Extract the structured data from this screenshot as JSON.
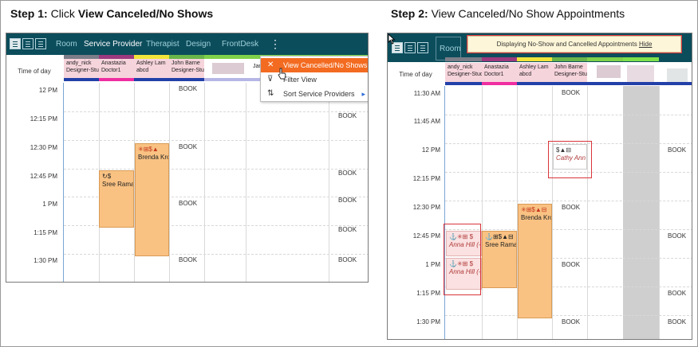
{
  "step1": {
    "label": "Step 1:",
    "text_pre": "Click ",
    "text_bold": "View Canceled/No Shows"
  },
  "step2": {
    "label": "Step 2:",
    "text": "View Canceled/No Show Appointments"
  },
  "tabs": [
    "Room",
    "Service Provider",
    "Therapist",
    "Design",
    "FrontDesk"
  ],
  "tab_room": "Room",
  "time_of_day": "Time of day",
  "left": {
    "providers": [
      {
        "name": "andy_nick",
        "role": "Designer-Stud"
      },
      {
        "name": "Anastazia",
        "role": "Doctor1"
      },
      {
        "name": "Ashley Lam",
        "role": "abcd"
      },
      {
        "name": "John Barne",
        "role": "Designer-Stud"
      },
      {
        "name": "Jan",
        "role": ""
      }
    ],
    "times": [
      "12 PM",
      "12:15 PM",
      "12:30 PM",
      "12:45 PM",
      "1 PM",
      "1:15 PM",
      "1:30 PM"
    ],
    "appts": [
      {
        "icons": "✳⊞$▲",
        "name": "Brenda Kro"
      },
      {
        "icons": "↻$",
        "name": "Sree Rama"
      }
    ],
    "menu": [
      {
        "icon": "✕",
        "label": "View Cancelled/No Shows"
      },
      {
        "icon": "⊽",
        "label": "Filter View"
      },
      {
        "icon": "⇅",
        "label": "Sort Service Providers"
      }
    ],
    "more_icon": "⋮",
    "submenu_arrow": "▸",
    "book": "BOOK"
  },
  "right": {
    "banner_text": "Displaying No-Show and Cancelled Appointments ",
    "banner_link": "Hide",
    "providers": [
      {
        "name": "andy_nick",
        "role": "Designer-Stud"
      },
      {
        "name": "Anastazia",
        "role": "Doctor1"
      },
      {
        "name": "Ashley Lam",
        "role": "abcd"
      },
      {
        "name": "John Barne",
        "role": "Designer-Stud"
      }
    ],
    "times": [
      "11:30 AM",
      "11:45 AM",
      "12 PM",
      "12:15 PM",
      "12:30 PM",
      "12:45 PM",
      "1 PM",
      "1:15 PM",
      "1:30 PM"
    ],
    "cancel_appt": {
      "icons": "$▲⊟",
      "name": "Cathy Ann"
    },
    "anna1": {
      "icons": "⚓✳⊞ $",
      "name": "Anna Hill (-"
    },
    "anna2": {
      "icons": "⚓✳⊞ $",
      "name": "Anna Hill (-"
    },
    "sree": {
      "icons": "⚓⊞$▲⊟",
      "name": "Sree Rama"
    },
    "brenda": {
      "icons": "✳⊞$▲⊟",
      "name": "Brenda Kro"
    },
    "book": "BOOK"
  },
  "colors": {
    "toolbar": "#0c4d5c",
    "menu_highlight": "#f36b21",
    "appt": "#f9c283",
    "cancel_box": "#d9343a"
  }
}
